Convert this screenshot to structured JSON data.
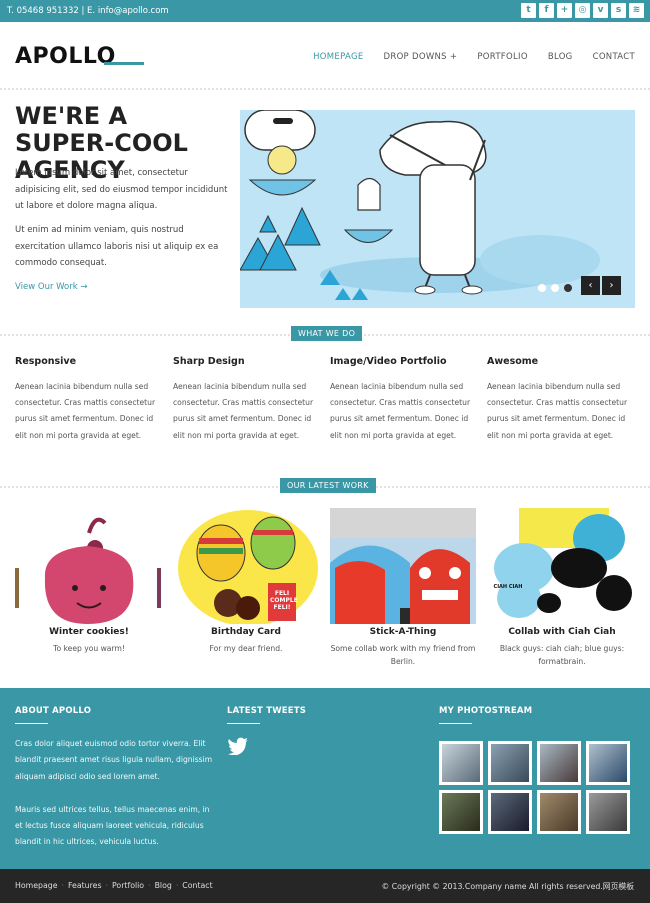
{
  "topbar": {
    "contact": "T. 05468 951332  |  E. info@apollo.com",
    "social": [
      "twitter",
      "facebook",
      "google-plus",
      "dribbble",
      "vimeo",
      "skype",
      "rss"
    ],
    "social_glyphs": [
      "t",
      "f",
      "+",
      "◎",
      "v",
      "s",
      "≋"
    ]
  },
  "header": {
    "logo": "APOLLO",
    "nav": [
      "HOMEPAGE",
      "DROP DOWNS  +",
      "PORTFOLIO",
      "BLOG",
      "CONTACT"
    ]
  },
  "hero": {
    "title": "WE'RE A SUPER-COOL AGENCY",
    "p1": "Lorem ipsum dolor sit amet, consectetur adipisicing elit, sed do eiusmod tempor incididunt ut labore et dolore magna aliqua.",
    "p2": "Ut enim ad minim veniam, quis nostrud exercitation ullamco laboris nisi ut aliquip ex ea commodo consequat.",
    "link": "View Our Work →",
    "prev": "‹",
    "next": "›"
  },
  "what_we_do": {
    "label": "WHAT WE DO",
    "features": [
      {
        "title": "Responsive",
        "text": "Aenean lacinia bibendum nulla sed consectetur. Cras mattis consectetur purus sit amet fermentum. Donec id elit non mi porta gravida at eget."
      },
      {
        "title": "Sharp Design",
        "text": "Aenean lacinia bibendum nulla sed consectetur. Cras mattis consectetur purus sit amet fermentum. Donec id elit non mi porta gravida at eget."
      },
      {
        "title": "Image/Video Portfolio",
        "text": "Aenean lacinia bibendum nulla sed consectetur. Cras mattis consectetur purus sit amet fermentum. Donec id elit non mi porta gravida at eget."
      },
      {
        "title": "Awesome",
        "text": "Aenean lacinia bibendum nulla sed consectetur. Cras mattis consectetur purus sit amet fermentum. Donec id elit non mi porta gravida at eget."
      }
    ]
  },
  "latest_work": {
    "label": "OUR LATEST WORK",
    "items": [
      {
        "title": "Winter cookies!",
        "sub": "To keep you warm!"
      },
      {
        "title": "Birthday Card",
        "sub": "For my dear friend.",
        "badge": "FELI COMPLE FELI!"
      },
      {
        "title": "Stick-A-Thing",
        "sub": "Some collab work with my friend from Berlin."
      },
      {
        "title": "Collab with Ciah Ciah",
        "sub": "Black guys: ciah ciah; blue guys: formatbrain.",
        "badge": "CIAH CIAH"
      }
    ]
  },
  "footer": {
    "about_title": "ABOUT APOLLO",
    "about_p1": "Cras dolor aliquet euismod odio tortor viverra. Elit blandit praesent amet risus ligula nullam, dignissim aliquam adipisci odio sed lorem amet.",
    "about_p2": "Mauris sed ultrices tellus, tellus maecenas enim, in et lectus fusce aliquam laoreet vehicula, ridiculus blandit in hic ultrices, vehicula luctus.",
    "tweets_title": "LATEST TWEETS",
    "photos_title": "MY PHOTOSTREAM"
  },
  "bottom": {
    "links": [
      "Homepage",
      "Features",
      "Portfolio",
      "Blog",
      "Contact"
    ],
    "copyright": "© Copyright © 2013.Company name All rights reserved.网页模板"
  },
  "colors": {
    "accent": "#3a97a6",
    "dark": "#262626"
  }
}
